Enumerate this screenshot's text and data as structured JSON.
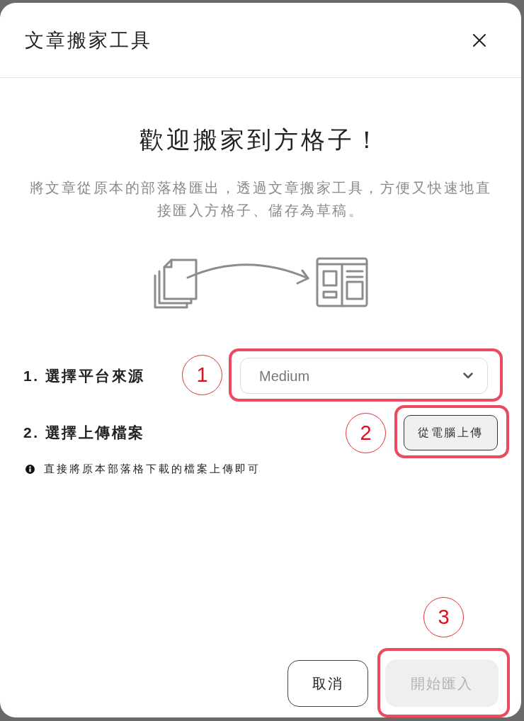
{
  "dialog": {
    "title": "文章搬家工具"
  },
  "intro": {
    "heading": "歡迎搬家到方格子！",
    "description": "將文章從原本的部落格匯出，透過文章搬家工具，方便又快速地直接匯入方格子、儲存為草稿。"
  },
  "steps": [
    {
      "kind": "select",
      "label": "1. 選擇平台來源",
      "value": "Medium"
    },
    {
      "kind": "upload",
      "label": "2. 選擇上傳檔案",
      "button": "從電腦上傳"
    }
  ],
  "hint": "直接將原本部落格下載的檔案上傳即可",
  "buttons": [
    {
      "kind": "secondary",
      "label": "取消",
      "disabled": false
    },
    {
      "kind": "primary",
      "label": "開始匯入",
      "disabled": true
    }
  ],
  "annotations": [
    {
      "label": "1"
    },
    {
      "label": "2"
    },
    {
      "label": "3"
    }
  ]
}
